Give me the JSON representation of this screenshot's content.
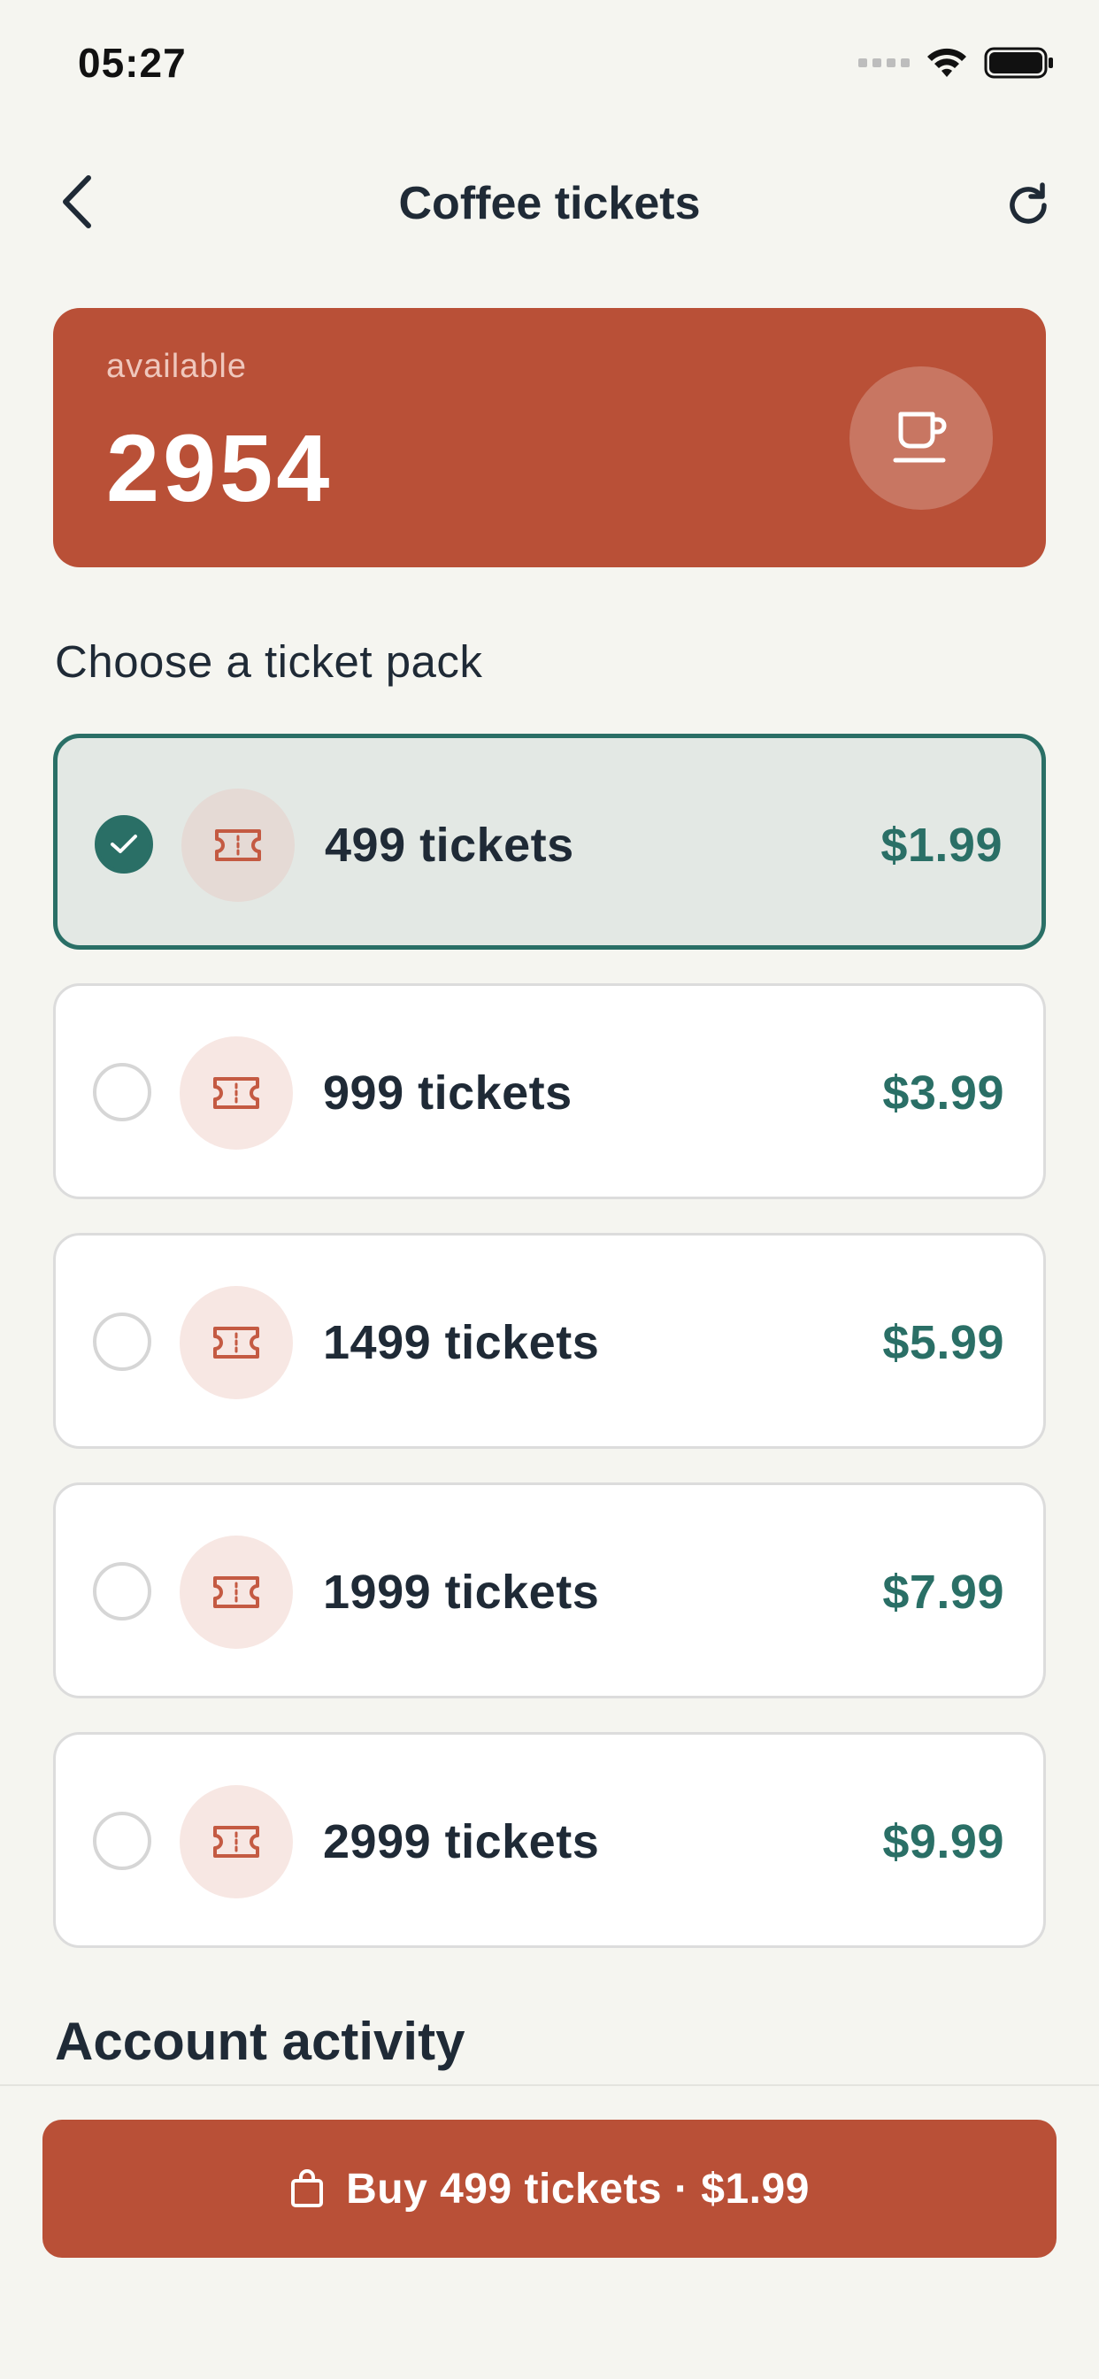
{
  "status_bar": {
    "time": "05:27"
  },
  "nav": {
    "title": "Coffee tickets"
  },
  "balance": {
    "label": "available",
    "value": "2954"
  },
  "section_heading": "Choose a ticket pack",
  "packs": [
    {
      "label": "499 tickets",
      "price": "$1.99",
      "selected": true
    },
    {
      "label": "999 tickets",
      "price": "$3.99",
      "selected": false
    },
    {
      "label": "1499 tickets",
      "price": "$5.99",
      "selected": false
    },
    {
      "label": "1999 tickets",
      "price": "$7.99",
      "selected": false
    },
    {
      "label": "2999 tickets",
      "price": "$9.99",
      "selected": false
    }
  ],
  "activity_heading": "Account activity",
  "buy_button": {
    "label": "Buy 499 tickets · $1.99"
  },
  "colors": {
    "accent": "#B95037",
    "selection": "#2A6F66",
    "text": "#1F2A36",
    "background": "#F5F5F0"
  },
  "icons": {
    "back": "chevron-left-icon",
    "refresh": "refresh-icon",
    "balance": "coffee-cup-icon",
    "pack": "ticket-icon",
    "check": "checkmark-icon",
    "buy": "shopping-bag-icon"
  }
}
